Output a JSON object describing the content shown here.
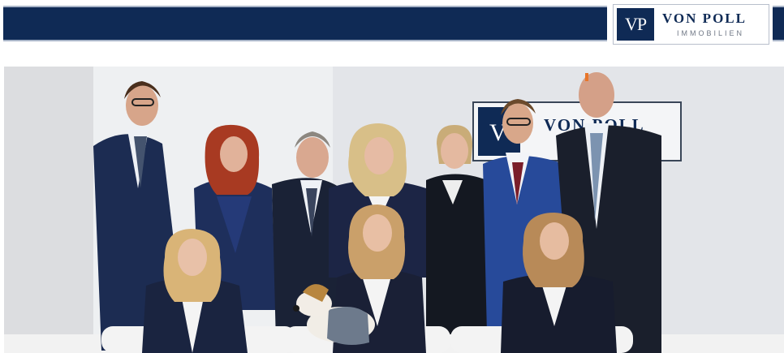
{
  "header": {
    "logo_mark": "VP",
    "brand_name": "VON POLL",
    "brand_sub": "IMMOBILIEN"
  },
  "photo": {
    "wall_logo_mark": "V",
    "wall_logo_text": "VON POLL"
  },
  "colors": {
    "brand_navy": "#0f2a55",
    "band_border": "#a9b5c8",
    "wall": "#e9eaed"
  }
}
